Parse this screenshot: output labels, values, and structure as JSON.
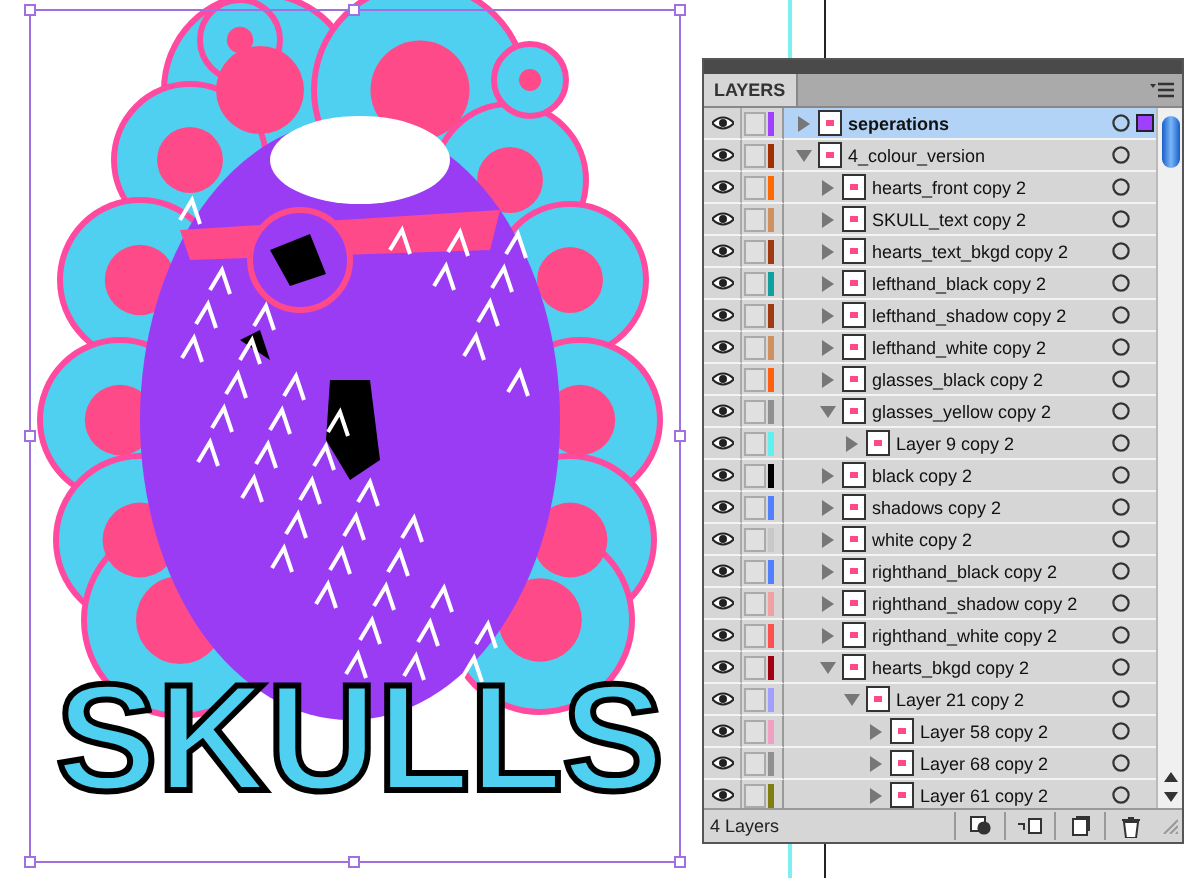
{
  "artboard": {
    "artwork_text": "SKULLS"
  },
  "layers_panel": {
    "title": "LAYERS",
    "layers": [
      {
        "name": "seperations",
        "visible": true,
        "selected": true,
        "expanded": false,
        "color": "#a040ff"
      },
      {
        "name": "4_colour_version",
        "visible": true,
        "selected": false,
        "expanded": true,
        "color": "#a03000",
        "children": [
          {
            "name": "hearts_front copy 2",
            "visible": true,
            "selected": false,
            "expanded": false,
            "color": "#ff6a00"
          },
          {
            "name": "SKULL_text copy 2",
            "visible": true,
            "selected": false,
            "expanded": false,
            "color": "#d09060"
          },
          {
            "name": "hearts_text_bkgd copy 2",
            "visible": true,
            "selected": false,
            "expanded": false,
            "color": "#a03a10"
          },
          {
            "name": "lefthand_black copy 2",
            "visible": true,
            "selected": false,
            "expanded": false,
            "color": "#10a0a0"
          },
          {
            "name": "lefthand_shadow copy 2",
            "visible": true,
            "selected": false,
            "expanded": false,
            "color": "#a03a10"
          },
          {
            "name": "lefthand_white copy 2",
            "visible": true,
            "selected": false,
            "expanded": false,
            "color": "#d09060"
          },
          {
            "name": "glasses_black copy 2",
            "visible": true,
            "selected": false,
            "expanded": false,
            "color": "#ff6010"
          },
          {
            "name": "glasses_yellow copy 2",
            "visible": true,
            "selected": false,
            "expanded": true,
            "color": "#909090",
            "children": [
              {
                "name": "Layer 9 copy 2",
                "visible": true,
                "selected": false,
                "expanded": false,
                "color": "#60f0f0"
              }
            ]
          },
          {
            "name": "black copy 2",
            "visible": true,
            "selected": false,
            "expanded": false,
            "color": "#000000"
          },
          {
            "name": "shadows copy 2",
            "visible": true,
            "selected": false,
            "expanded": false,
            "color": "#5080ff"
          },
          {
            "name": "white copy 2",
            "visible": true,
            "selected": false,
            "expanded": false,
            "color": "#c8c8c8"
          },
          {
            "name": "righthand_black copy 2",
            "visible": true,
            "selected": false,
            "expanded": false,
            "color": "#5080ff"
          },
          {
            "name": "righthand_shadow copy 2",
            "visible": true,
            "selected": false,
            "expanded": false,
            "color": "#f0a0a0"
          },
          {
            "name": "righthand_white copy 2",
            "visible": true,
            "selected": false,
            "expanded": false,
            "color": "#ff5050"
          },
          {
            "name": "hearts_bkgd copy 2",
            "visible": true,
            "selected": false,
            "expanded": true,
            "color": "#a00010",
            "children": [
              {
                "name": "Layer 21 copy 2",
                "visible": true,
                "selected": false,
                "expanded": true,
                "color": "#a0a0ff",
                "children": [
                  {
                    "name": "Layer 58 copy 2",
                    "visible": true,
                    "selected": false,
                    "expanded": false,
                    "color": "#f0a0c0"
                  },
                  {
                    "name": "Layer 68 copy 2",
                    "visible": true,
                    "selected": false,
                    "expanded": false,
                    "color": "#909090"
                  },
                  {
                    "name": "Layer 61 copy 2",
                    "visible": true,
                    "selected": false,
                    "expanded": false,
                    "color": "#808010"
                  }
                ]
              }
            ]
          }
        ]
      }
    ],
    "status": "4 Layers"
  }
}
